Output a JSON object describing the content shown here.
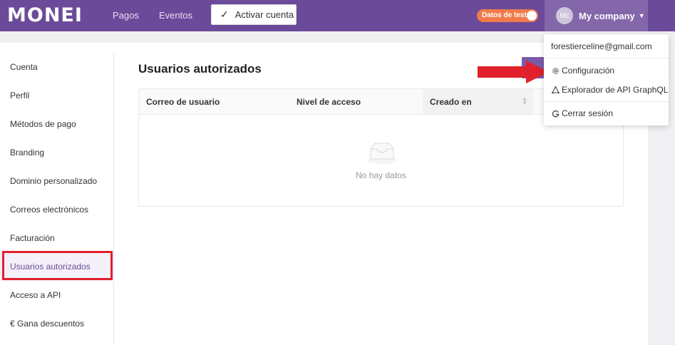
{
  "brand": {
    "logo": "MONEI"
  },
  "nav": {
    "pagos": "Pagos",
    "eventos": "Eventos",
    "activate": "Activar cuenta"
  },
  "test_toggle": {
    "label": "Datos de test"
  },
  "account": {
    "initials": "Mc",
    "company": "My company"
  },
  "sidebar": {
    "items": [
      {
        "label": "Cuenta"
      },
      {
        "label": "Perfil"
      },
      {
        "label": "Métodos de pago"
      },
      {
        "label": "Branding"
      },
      {
        "label": "Dominio personalizado"
      },
      {
        "label": "Correos electrónicos"
      },
      {
        "label": "Facturación"
      },
      {
        "label": "Usuarios autorizados"
      },
      {
        "label": "Acceso a API"
      },
      {
        "label": "€ Gana descuentos"
      }
    ],
    "active_index": 7
  },
  "main": {
    "title": "Usuarios autorizados",
    "table": {
      "columns": [
        "Correo de usuario",
        "Nivel de acceso",
        "Creado en"
      ],
      "empty_text": "No hay datos"
    }
  },
  "dropdown": {
    "email": "forestierceline@gmail.com",
    "items": [
      {
        "label": "Configuración",
        "icon": "gear-icon"
      },
      {
        "label": "Explorador de API GraphQL",
        "icon": "graphql-icon"
      },
      {
        "label": "Cerrar sesión",
        "icon": "google-icon"
      }
    ]
  },
  "colors": {
    "brand": "#6c4a9a",
    "test_toggle": "#f07b4a",
    "annotation": "#e0202a"
  }
}
